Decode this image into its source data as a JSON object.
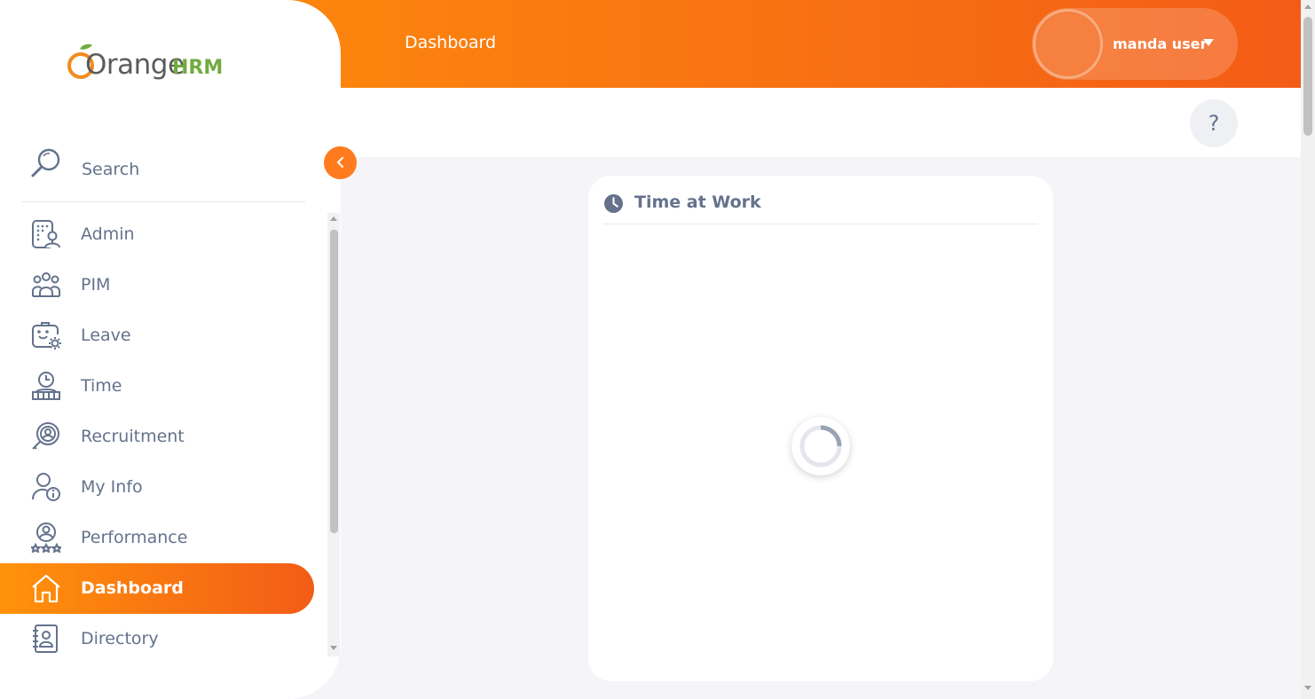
{
  "app": {
    "name": "OrangeHRM",
    "logo_word": "Orange",
    "logo_suffix": "HRM"
  },
  "header": {
    "title": "Dashboard",
    "user_name": "manda user"
  },
  "help": {
    "label": "?"
  },
  "sidebar": {
    "search_label": "Search",
    "items": [
      {
        "label": "Admin",
        "icon": "admin-icon"
      },
      {
        "label": "PIM",
        "icon": "pim-icon"
      },
      {
        "label": "Leave",
        "icon": "leave-icon"
      },
      {
        "label": "Time",
        "icon": "time-icon"
      },
      {
        "label": "Recruitment",
        "icon": "recruitment-icon"
      },
      {
        "label": "My Info",
        "icon": "my-info-icon"
      },
      {
        "label": "Performance",
        "icon": "performance-icon"
      },
      {
        "label": "Dashboard",
        "icon": "dashboard-icon",
        "active": true
      },
      {
        "label": "Directory",
        "icon": "directory-icon"
      }
    ]
  },
  "widget": {
    "title": "Time at Work",
    "state": "loading"
  },
  "colors": {
    "accent_start": "#ff920b",
    "accent_end": "#f35c17",
    "text": "#64728c",
    "logo_green": "#71ab3f"
  }
}
